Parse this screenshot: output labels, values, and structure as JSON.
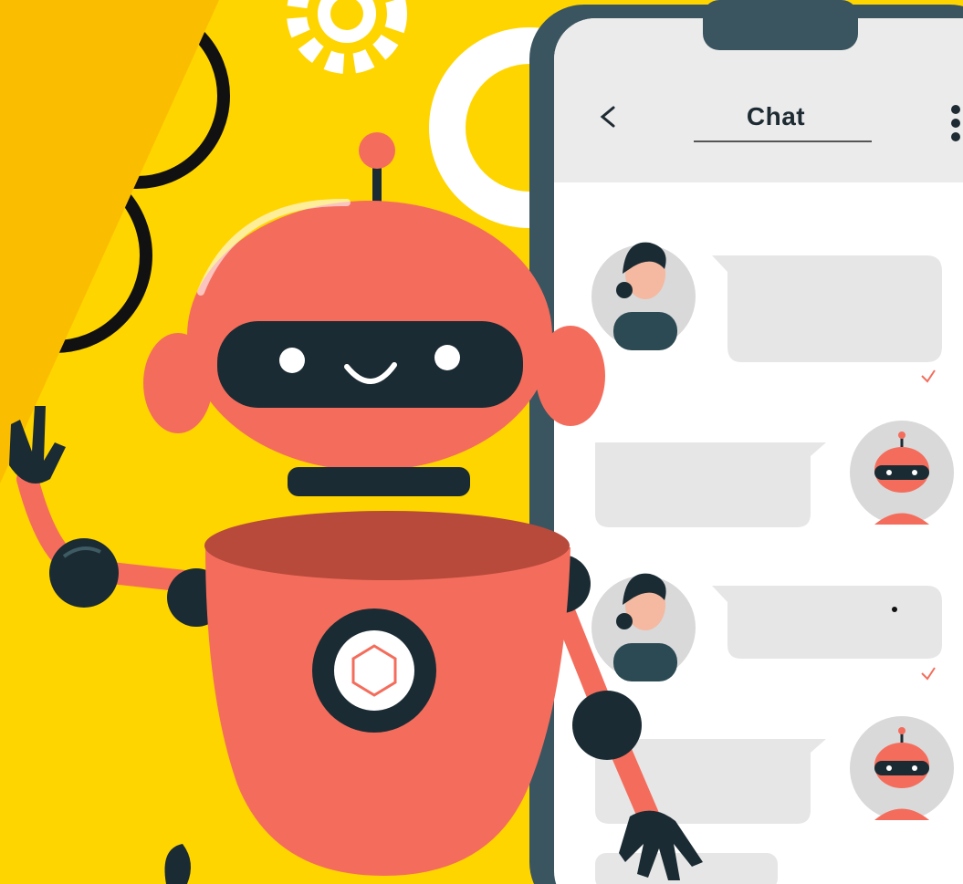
{
  "chat_header": {
    "title": "Chat",
    "back_icon": "chevron-left-icon",
    "menu_icon": "more-vertical-icon"
  },
  "colors": {
    "background": "#ffd500",
    "robot_body": "#f46d5c",
    "robot_shade": "#b84a3c",
    "robot_dark": "#1b2b33",
    "phone_frame": "#3a5560",
    "chat_bubble": "#e6e6e6",
    "corner_band": "#fbbd00"
  },
  "messages": [
    {
      "sender": "user",
      "avatar": "woman-avatar"
    },
    {
      "sender": "bot",
      "avatar": "robot-avatar"
    },
    {
      "sender": "user",
      "avatar": "woman-avatar"
    },
    {
      "sender": "bot",
      "avatar": "robot-avatar"
    }
  ]
}
